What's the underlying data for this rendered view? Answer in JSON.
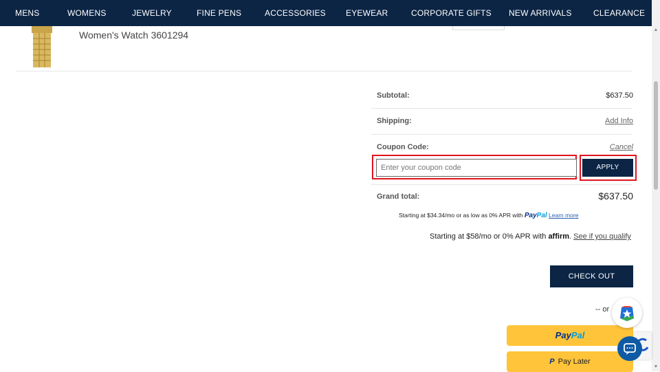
{
  "nav": {
    "items": [
      "MENS",
      "WOMENS",
      "JEWELRY",
      "FINE PENS",
      "ACCESSORIES",
      "EYEWEAR",
      "CORPORATE GIFTS",
      "NEW ARRIVALS",
      "CLEARANCE"
    ]
  },
  "product": {
    "name": "Women's Watch 3601294",
    "image_icon": "gold-watch-icon"
  },
  "summary": {
    "subtotal_label": "Subtotal:",
    "subtotal_value": "$637.50",
    "shipping_label": "Shipping:",
    "shipping_link": "Add Info",
    "coupon_label": "Coupon Code:",
    "coupon_cancel": "Cancel",
    "coupon_placeholder": "Enter your coupon code",
    "coupon_value": "",
    "apply_label": "APPLY",
    "grand_label": "Grand total:",
    "grand_value": "$637.50"
  },
  "financing": {
    "paypal_text": "Starting at $34.34/mo or as low as 0% APR with",
    "paypal_brand_a": "Pay",
    "paypal_brand_b": "Pal",
    "paypal_link": "Learn more",
    "affirm_text": "Starting at $58/mo or 0% APR with",
    "affirm_brand": "affirm",
    "affirm_link": "See if you qualify"
  },
  "checkout": {
    "button_label": "CHECK OUT",
    "or_text": "-- or",
    "paypal_a": "Pay",
    "paypal_b": "Pal",
    "paylater_mark": "P",
    "paylater_label": "Pay Later"
  },
  "colors": {
    "nav_bg": "#0c2545",
    "highlight": "#e0141e",
    "paypal_yellow": "#ffc439"
  }
}
